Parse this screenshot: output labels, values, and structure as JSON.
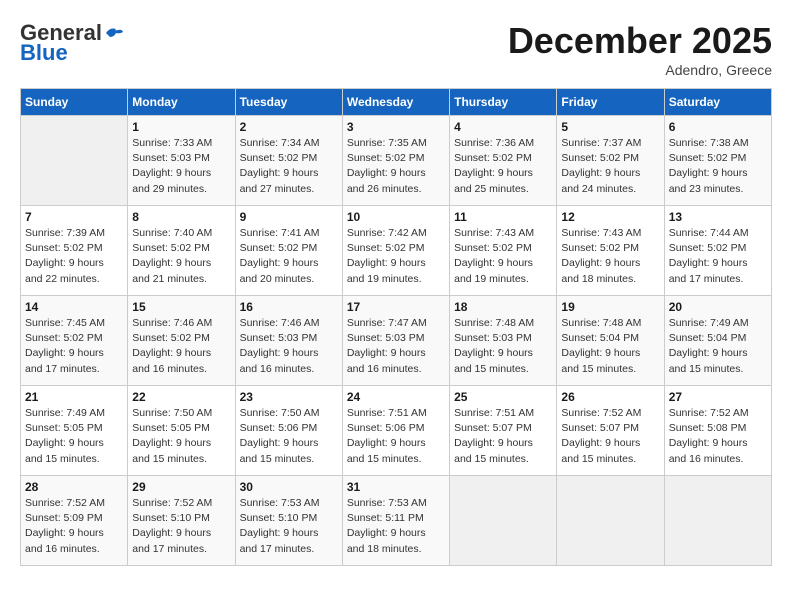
{
  "header": {
    "logo_general": "General",
    "logo_blue": "Blue",
    "month_title": "December 2025",
    "subtitle": "Adendro, Greece"
  },
  "columns": [
    "Sunday",
    "Monday",
    "Tuesday",
    "Wednesday",
    "Thursday",
    "Friday",
    "Saturday"
  ],
  "weeks": [
    [
      {
        "day": "",
        "info": ""
      },
      {
        "day": "1",
        "info": "Sunrise: 7:33 AM\nSunset: 5:03 PM\nDaylight: 9 hours\nand 29 minutes."
      },
      {
        "day": "2",
        "info": "Sunrise: 7:34 AM\nSunset: 5:02 PM\nDaylight: 9 hours\nand 27 minutes."
      },
      {
        "day": "3",
        "info": "Sunrise: 7:35 AM\nSunset: 5:02 PM\nDaylight: 9 hours\nand 26 minutes."
      },
      {
        "day": "4",
        "info": "Sunrise: 7:36 AM\nSunset: 5:02 PM\nDaylight: 9 hours\nand 25 minutes."
      },
      {
        "day": "5",
        "info": "Sunrise: 7:37 AM\nSunset: 5:02 PM\nDaylight: 9 hours\nand 24 minutes."
      },
      {
        "day": "6",
        "info": "Sunrise: 7:38 AM\nSunset: 5:02 PM\nDaylight: 9 hours\nand 23 minutes."
      }
    ],
    [
      {
        "day": "7",
        "info": "Sunrise: 7:39 AM\nSunset: 5:02 PM\nDaylight: 9 hours\nand 22 minutes."
      },
      {
        "day": "8",
        "info": "Sunrise: 7:40 AM\nSunset: 5:02 PM\nDaylight: 9 hours\nand 21 minutes."
      },
      {
        "day": "9",
        "info": "Sunrise: 7:41 AM\nSunset: 5:02 PM\nDaylight: 9 hours\nand 20 minutes."
      },
      {
        "day": "10",
        "info": "Sunrise: 7:42 AM\nSunset: 5:02 PM\nDaylight: 9 hours\nand 19 minutes."
      },
      {
        "day": "11",
        "info": "Sunrise: 7:43 AM\nSunset: 5:02 PM\nDaylight: 9 hours\nand 19 minutes."
      },
      {
        "day": "12",
        "info": "Sunrise: 7:43 AM\nSunset: 5:02 PM\nDaylight: 9 hours\nand 18 minutes."
      },
      {
        "day": "13",
        "info": "Sunrise: 7:44 AM\nSunset: 5:02 PM\nDaylight: 9 hours\nand 17 minutes."
      }
    ],
    [
      {
        "day": "14",
        "info": "Sunrise: 7:45 AM\nSunset: 5:02 PM\nDaylight: 9 hours\nand 17 minutes."
      },
      {
        "day": "15",
        "info": "Sunrise: 7:46 AM\nSunset: 5:02 PM\nDaylight: 9 hours\nand 16 minutes."
      },
      {
        "day": "16",
        "info": "Sunrise: 7:46 AM\nSunset: 5:03 PM\nDaylight: 9 hours\nand 16 minutes."
      },
      {
        "day": "17",
        "info": "Sunrise: 7:47 AM\nSunset: 5:03 PM\nDaylight: 9 hours\nand 16 minutes."
      },
      {
        "day": "18",
        "info": "Sunrise: 7:48 AM\nSunset: 5:03 PM\nDaylight: 9 hours\nand 15 minutes."
      },
      {
        "day": "19",
        "info": "Sunrise: 7:48 AM\nSunset: 5:04 PM\nDaylight: 9 hours\nand 15 minutes."
      },
      {
        "day": "20",
        "info": "Sunrise: 7:49 AM\nSunset: 5:04 PM\nDaylight: 9 hours\nand 15 minutes."
      }
    ],
    [
      {
        "day": "21",
        "info": "Sunrise: 7:49 AM\nSunset: 5:05 PM\nDaylight: 9 hours\nand 15 minutes."
      },
      {
        "day": "22",
        "info": "Sunrise: 7:50 AM\nSunset: 5:05 PM\nDaylight: 9 hours\nand 15 minutes."
      },
      {
        "day": "23",
        "info": "Sunrise: 7:50 AM\nSunset: 5:06 PM\nDaylight: 9 hours\nand 15 minutes."
      },
      {
        "day": "24",
        "info": "Sunrise: 7:51 AM\nSunset: 5:06 PM\nDaylight: 9 hours\nand 15 minutes."
      },
      {
        "day": "25",
        "info": "Sunrise: 7:51 AM\nSunset: 5:07 PM\nDaylight: 9 hours\nand 15 minutes."
      },
      {
        "day": "26",
        "info": "Sunrise: 7:52 AM\nSunset: 5:07 PM\nDaylight: 9 hours\nand 15 minutes."
      },
      {
        "day": "27",
        "info": "Sunrise: 7:52 AM\nSunset: 5:08 PM\nDaylight: 9 hours\nand 16 minutes."
      }
    ],
    [
      {
        "day": "28",
        "info": "Sunrise: 7:52 AM\nSunset: 5:09 PM\nDaylight: 9 hours\nand 16 minutes."
      },
      {
        "day": "29",
        "info": "Sunrise: 7:52 AM\nSunset: 5:10 PM\nDaylight: 9 hours\nand 17 minutes."
      },
      {
        "day": "30",
        "info": "Sunrise: 7:53 AM\nSunset: 5:10 PM\nDaylight: 9 hours\nand 17 minutes."
      },
      {
        "day": "31",
        "info": "Sunrise: 7:53 AM\nSunset: 5:11 PM\nDaylight: 9 hours\nand 18 minutes."
      },
      {
        "day": "",
        "info": ""
      },
      {
        "day": "",
        "info": ""
      },
      {
        "day": "",
        "info": ""
      }
    ]
  ]
}
